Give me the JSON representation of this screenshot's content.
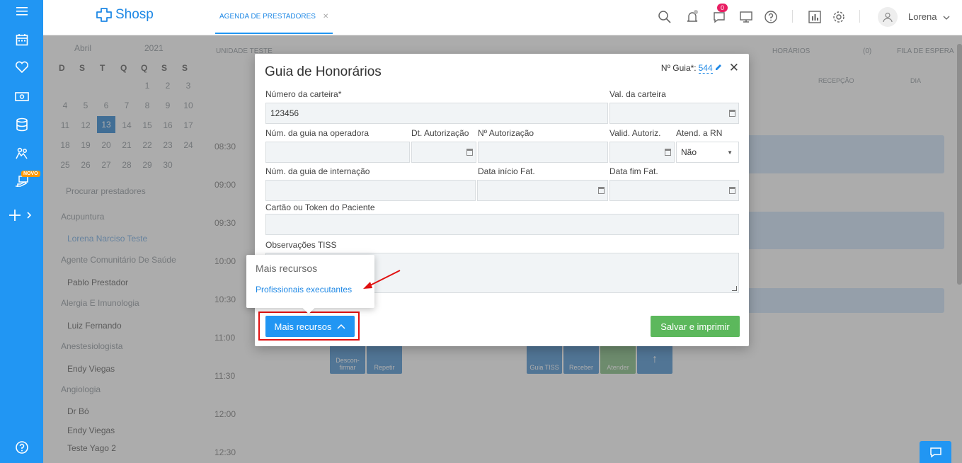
{
  "app": {
    "logo_text": "Shosp",
    "brand_color": "#2196f3"
  },
  "sidebar": {
    "novo_badge": "NOVO",
    "icons": [
      "menu-icon",
      "calendar-icon",
      "heart-icon",
      "money-icon",
      "database-icon",
      "people-icon",
      "hand-money-icon",
      "plus-icon",
      "help-icon"
    ]
  },
  "topbar": {
    "tab_label": "AGENDA DE PRESTADORES",
    "notifications_count": "0",
    "user_name": "Lorena"
  },
  "background": {
    "unidade": "UNIDADE TESTE",
    "month": "Abril",
    "year": "2021",
    "weekdays": [
      "D",
      "S",
      "T",
      "Q",
      "Q",
      "S",
      "S"
    ],
    "calendar_rows": [
      [
        "",
        "",
        "",
        "",
        "1",
        "2",
        "3"
      ],
      [
        "4",
        "5",
        "6",
        "7",
        "8",
        "9",
        "10"
      ],
      [
        "11",
        "12",
        "13",
        "14",
        "15",
        "16",
        "17"
      ],
      [
        "18",
        "19",
        "20",
        "21",
        "22",
        "23",
        "24"
      ],
      [
        "25",
        "26",
        "27",
        "28",
        "29",
        "30",
        ""
      ]
    ],
    "search_placeholder": "Procurar prestadores",
    "providers": [
      {
        "text": "Acupuntura",
        "type": "group"
      },
      {
        "text": "Lorena Narciso Teste",
        "type": "link"
      },
      {
        "text": "Agente Comunitário De Saúde",
        "type": "group"
      },
      {
        "text": "Pablo Prestador",
        "type": "item"
      },
      {
        "text": "Alergia E Imunologia",
        "type": "group"
      },
      {
        "text": "Luiz Fernando",
        "type": "item"
      },
      {
        "text": "Anestesiologista",
        "type": "group"
      },
      {
        "text": "Endy Viegas",
        "type": "item"
      },
      {
        "text": "Angiologia",
        "type": "group"
      },
      {
        "text": "Dr Bó",
        "type": "item"
      },
      {
        "text": "Endy Viegas",
        "type": "item"
      },
      {
        "text": "Teste Yago 2",
        "type": "item"
      }
    ],
    "times": [
      "08:30",
      "09:00",
      "09:30",
      "10:00",
      "10:30",
      "11:00",
      "11:30",
      "12:00",
      "12:30"
    ],
    "header_links": [
      "HORÁRIOS",
      "(0)",
      "FILA DE ESPERA",
      "RECEPÇÃO",
      "DIA"
    ],
    "action_buttons": [
      "Descon-firmar",
      "Repetir",
      "Guia TISS",
      "Receber",
      "Atender"
    ]
  },
  "modal": {
    "title": "Guia de Honorários",
    "guia_label": "Nº Guia*:",
    "guia_number": "544",
    "fields": {
      "numero_carteira_label": "Número da carteira*",
      "numero_carteira_value": "123456",
      "val_carteira_label": "Val. da carteira",
      "num_guia_operadora_label": "Núm. da guia na operadora",
      "dt_autorizacao_label": "Dt. Autorização",
      "n_autorizacao_label": "Nº Autorização",
      "valid_autoriz_label": "Valid. Autoriz.",
      "atend_rn_label": "Atend. a RN",
      "atend_rn_value": "Não",
      "num_guia_internacao_label": "Núm. da guia de internação",
      "data_inicio_label": "Data início Fat.",
      "data_fim_label": "Data fim Fat.",
      "cartao_token_label": "Cartão ou Token do Paciente",
      "observacoes_label": "Observações TISS"
    },
    "mais_recursos_button": "Mais recursos",
    "salvar_button": "Salvar e imprimir"
  },
  "popover": {
    "title": "Mais recursos",
    "link": "Profissionais executantes"
  }
}
